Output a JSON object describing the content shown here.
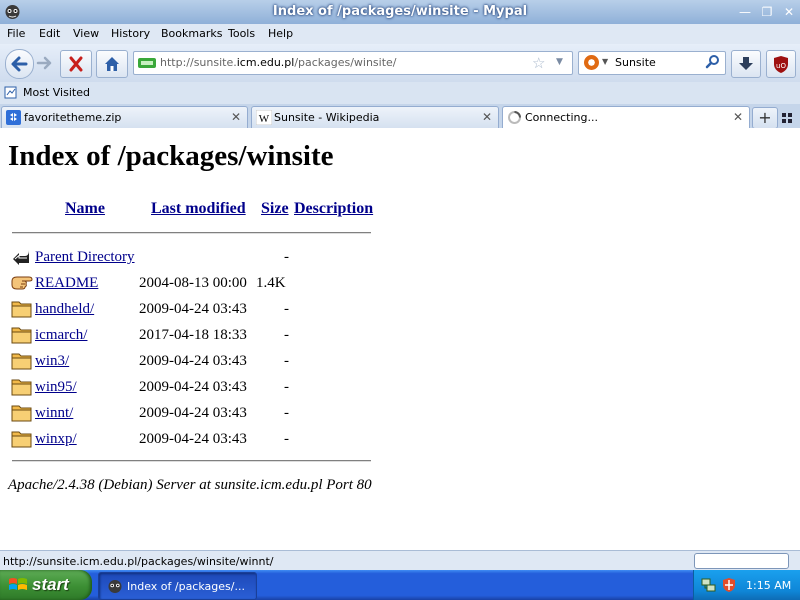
{
  "window": {
    "title": "Index of /packages/winsite - Mypal"
  },
  "menu": [
    "File",
    "Edit",
    "View",
    "History",
    "Bookmarks",
    "Tools",
    "Help"
  ],
  "address": {
    "url_prefix": "http://sunsite.",
    "url_domain": "icm.edu.pl",
    "url_path": "/packages/winsite/"
  },
  "search": {
    "engine": "Sunsite"
  },
  "bookmarks": {
    "item": "Most Visited"
  },
  "tabs": [
    {
      "label": "favoritetheme.zip",
      "icon": "dropbox-icon"
    },
    {
      "label": "Sunsite - Wikipedia",
      "icon": "wikipedia-icon"
    },
    {
      "label": "Connecting...",
      "icon": "loading-icon"
    }
  ],
  "page": {
    "heading": "Index of /packages/winsite",
    "columns": {
      "name": "Name",
      "modified": "Last modified",
      "size": "Size",
      "description": "Description"
    },
    "rows": [
      {
        "name": "Parent Directory",
        "date": "",
        "size": "-",
        "icon": "parent-directory-icon"
      },
      {
        "name": "README",
        "date": "2004-08-13 00:00",
        "size": "1.4K",
        "icon": "readme-hand-icon"
      },
      {
        "name": "handheld/",
        "date": "2009-04-24 03:43",
        "size": "-",
        "icon": "folder-icon"
      },
      {
        "name": "icmarch/",
        "date": "2017-04-18 18:33",
        "size": "-",
        "icon": "folder-icon"
      },
      {
        "name": "win3/",
        "date": "2009-04-24 03:43",
        "size": "-",
        "icon": "folder-icon"
      },
      {
        "name": "win95/",
        "date": "2009-04-24 03:43",
        "size": "-",
        "icon": "folder-icon"
      },
      {
        "name": "winnt/",
        "date": "2009-04-24 03:43",
        "size": "-",
        "icon": "folder-icon"
      },
      {
        "name": "winxp/",
        "date": "2009-04-24 03:43",
        "size": "-",
        "icon": "folder-icon"
      }
    ],
    "address_line": "Apache/2.4.38 (Debian) Server at sunsite.icm.edu.pl Port 80"
  },
  "status": {
    "text": "http://sunsite.icm.edu.pl/packages/winsite/winnt/"
  },
  "taskbar": {
    "start": "start",
    "task_label": "Index of /packages/...",
    "clock": "1:15 AM"
  },
  "colors": {
    "link": "#00008b",
    "taskbar": "#245edb",
    "start_green": "#3c8f34"
  }
}
